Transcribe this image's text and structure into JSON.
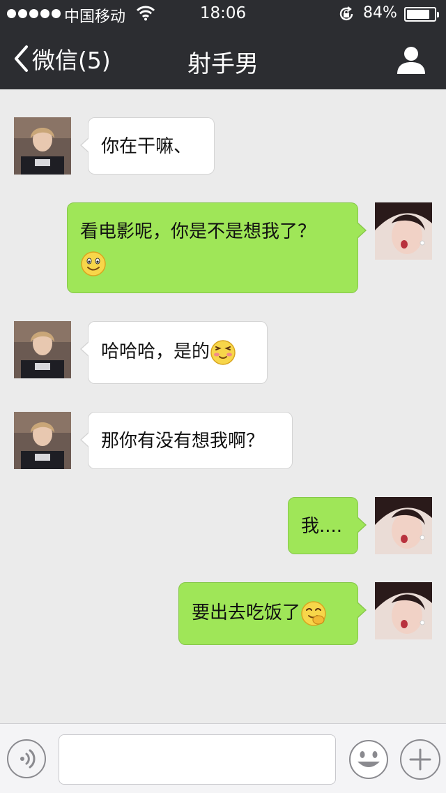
{
  "status_bar": {
    "carrier": "中国移动",
    "time": "18:06",
    "battery_percent": "84%",
    "battery_level": 0.84,
    "icons": [
      "signal-dots-icon",
      "wifi-icon",
      "rotation-lock-icon",
      "battery-icon"
    ]
  },
  "nav": {
    "back_label": "微信(5)",
    "title": "射手男",
    "back_icon": "chevron-left-icon",
    "profile_icon": "person-icon"
  },
  "messages": [
    {
      "side": "in",
      "text": "你在干嘛、",
      "emoji": null
    },
    {
      "side": "out",
      "lines": [
        "看电影呢，你是不是想我了？"
      ],
      "emoji": "smile"
    },
    {
      "side": "in",
      "text": "哈哈哈，是的",
      "emoji": "shy"
    },
    {
      "side": "in",
      "text": "那你有没有想我啊？",
      "emoji": null
    },
    {
      "side": "out",
      "text": "我....",
      "emoji": null
    },
    {
      "side": "out",
      "text": "要出去吃饭了",
      "emoji": "giggle"
    }
  ],
  "input_bar": {
    "input_value": "",
    "icons": [
      "voice-icon",
      "emoji-face-icon",
      "plus-icon"
    ]
  },
  "colors": {
    "bar": "#2c2d31",
    "background": "#ebebeb",
    "outgoing_bubble": "#9fe658",
    "incoming_bubble": "#ffffff"
  }
}
